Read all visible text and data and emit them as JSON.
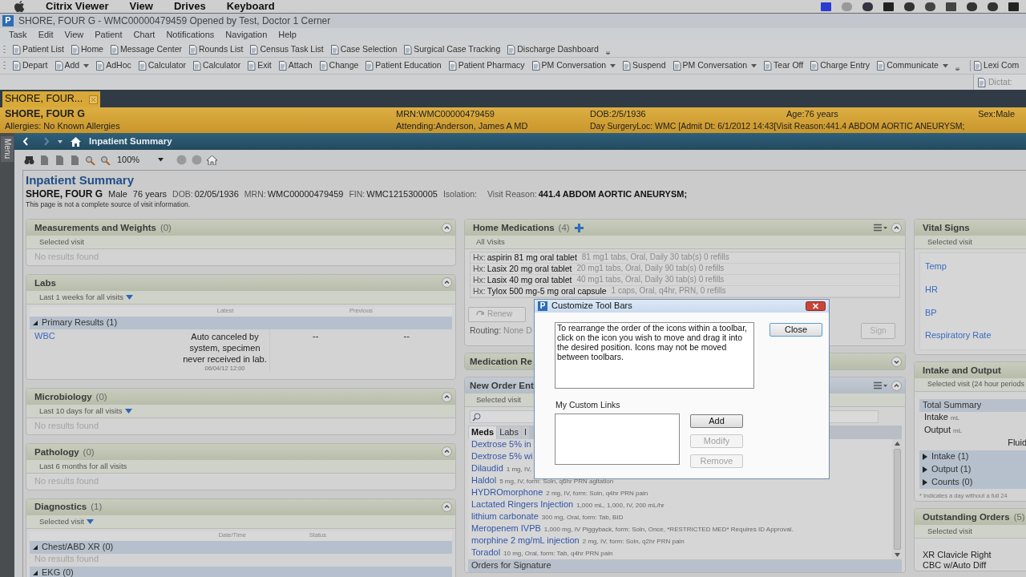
{
  "mac_menu": [
    "Citrix Viewer",
    "View",
    "Drives",
    "Keyboard"
  ],
  "window": {
    "icon_letter": "P",
    "title": "SHORE, FOUR G  - WMC00000479459 Opened by Test, Doctor 1 Cerner"
  },
  "menu": [
    "Task",
    "Edit",
    "View",
    "Patient",
    "Chart",
    "Notifications",
    "Navigation",
    "Help"
  ],
  "toolbar_1": [
    {
      "label": "Patient List",
      "dropdown": false
    },
    {
      "label": "Home",
      "dropdown": false
    },
    {
      "label": "Message Center",
      "dropdown": false
    },
    {
      "label": "Rounds List",
      "dropdown": false
    },
    {
      "label": "Census Task List",
      "dropdown": false
    },
    {
      "label": "Case Selection",
      "dropdown": false
    },
    {
      "label": "Surgical Case Tracking",
      "dropdown": false
    },
    {
      "label": "Discharge Dashboard",
      "dropdown": false
    }
  ],
  "toolbar_2": [
    {
      "label": "Depart",
      "dropdown": false
    },
    {
      "label": "Add",
      "dropdown": true
    },
    {
      "label": "AdHoc",
      "dropdown": false
    },
    {
      "label": "Calculator",
      "dropdown": false
    },
    {
      "label": "Calculator",
      "dropdown": false
    },
    {
      "label": "Exit",
      "dropdown": false
    },
    {
      "label": "Attach",
      "dropdown": false
    },
    {
      "label": "Change",
      "dropdown": false
    },
    {
      "label": "Patient Education",
      "dropdown": false
    },
    {
      "label": "Patient Pharmacy",
      "dropdown": false
    },
    {
      "label": "PM Conversation",
      "dropdown": true
    },
    {
      "label": "Suspend",
      "dropdown": false
    },
    {
      "label": "PM Conversation",
      "dropdown": true
    },
    {
      "label": "Tear Off",
      "dropdown": false
    },
    {
      "label": "Charge Entry",
      "dropdown": false
    },
    {
      "label": "Communicate",
      "dropdown": true
    }
  ],
  "toolbar_2_end": {
    "label": "Lexi Com"
  },
  "toolbar_3": {
    "label": "Dictat:"
  },
  "patient_tab": {
    "label": "SHORE, FOUR..."
  },
  "banner": {
    "name": "SHORE, FOUR G",
    "allergies": "Allergies: No Known Allergies",
    "mrn": "MRN:WMC00000479459",
    "attending": "Attending:Anderson, James A MD",
    "dob": "DOB:2/5/1936",
    "visit": "Day SurgeryLoc: WMC [Admit Dt: 6/1/2012 14:43[Visit Reason:441.4  ABDOM AORTIC ANEURYSM;",
    "age": "Age:76 years",
    "sex": "Sex:Male"
  },
  "side_menu": {
    "label": "Menu"
  },
  "nav": {
    "title": "Inpatient Summary"
  },
  "page_toolbar": {
    "zoom": "100%"
  },
  "page": {
    "title": "Inpatient Summary",
    "patient": "SHORE, FOUR G",
    "demographics": [
      {
        "kind": "plain",
        "value": "Male"
      },
      {
        "kind": "plain",
        "value": "76 years"
      },
      {
        "kind": "field",
        "label": "DOB:",
        "value": "02/05/1936"
      },
      {
        "kind": "field",
        "label": "MRN:",
        "value": "WMC00000479459"
      },
      {
        "kind": "field",
        "label": "FIN:",
        "value": "WMC1215300005"
      },
      {
        "kind": "field",
        "label": "Isolation:"
      },
      {
        "kind": "reason",
        "label": "Visit Reason:",
        "value": "441.4 ABDOM AORTIC ANEURYSM;"
      }
    ],
    "note": "This page is not a complete source of visit information."
  },
  "left_column": [
    {
      "kind": "empty",
      "title": "Measurements and Weights",
      "count": "(0)",
      "collapsed": false,
      "filter": {
        "label": "Selected visit",
        "dropdown": false
      },
      "body": "No results found"
    },
    {
      "kind": "labs",
      "title": "Labs",
      "collapsed": false,
      "filter": {
        "label": "Last 1 weeks for all visits",
        "dropdown": true
      },
      "columns": [
        "Latest",
        "Previous"
      ],
      "groups": [
        {
          "label": "Primary Results (1)",
          "expanded": true,
          "rows": [
            {
              "name": "WBC",
              "latest": "Auto canceled by system, specimen never received in lab.",
              "time": "06/04/12 12:00",
              "previous": [
                "--",
                "--"
              ]
            }
          ]
        }
      ]
    },
    {
      "kind": "empty",
      "title": "Microbiology",
      "count": "(0)",
      "collapsed": false,
      "filter": {
        "label": "Last 10 days for all visits",
        "dropdown": true
      },
      "body": "No results found"
    },
    {
      "kind": "empty",
      "title": "Pathology",
      "count": "(0)",
      "collapsed": false,
      "filter": {
        "label": "Last 6 months for all visits",
        "dropdown": false
      },
      "body": "No results found"
    },
    {
      "kind": "diagnostics",
      "title": "Diagnostics",
      "count": "(1)",
      "collapsed": false,
      "filter": {
        "label": "Selected visit",
        "dropdown": true
      },
      "columns": [
        "Date/Time",
        "Status"
      ],
      "groups": [
        {
          "label": "Chest/ABD XR (0)",
          "expanded": true,
          "body": "No results found"
        },
        {
          "label": "EKG (0)",
          "expanded": true
        }
      ]
    }
  ],
  "home_medications": {
    "title": "Home Medications",
    "count": "(4)",
    "collapsed": false,
    "filter": "All Visits",
    "meds": [
      {
        "prefix": "Hx:",
        "name": "aspirin 81 mg oral tablet",
        "details": "81 mg1 tabs, Oral, Daily  30 tab(s) 0 refills"
      },
      {
        "prefix": "Hx:",
        "name": "Lasix 20 mg oral tablet",
        "details": "20 mg1 tabs, Oral, Daily  90 tab(s) 0 refills"
      },
      {
        "prefix": "Hx:",
        "name": "Lasix 40 mg oral tablet",
        "details": "40 mg1 tabs, Oral, Daily  30 tab(s) 0 refills"
      },
      {
        "prefix": "Hx:",
        "name": "Tylox 500 mg-5 mg oral capsule",
        "details": "1 caps, Oral, q4hr, PRN,  0 refills"
      }
    ],
    "renew_button": "Renew",
    "routing_label": "Routing:",
    "routing_value": "None D",
    "sign_button": "Sign"
  },
  "medication_rec": {
    "title": "Medication Re",
    "collapsed": true
  },
  "new_order_entry": {
    "title": "New Order Ent",
    "collapsed": false,
    "filter": "Selected visit",
    "tabs": [
      {
        "label": "Meds",
        "selected": true
      },
      {
        "label": "Labs",
        "selected": false
      },
      {
        "label": "I",
        "selected": false
      }
    ],
    "orders": [
      {
        "name": "Dextrose 5% in"
      },
      {
        "name": "Dextrose 5% wi"
      },
      {
        "name": "Dilaudid",
        "details": "1 mg, IV,"
      },
      {
        "name": "Haldol",
        "details": "5 mg, IV, form: Soln, q6hr PRN agitation"
      },
      {
        "name": "HYDROmorphone",
        "details": "2 mg, IV, form: Soln, q4hr PRN pain"
      },
      {
        "name": "Lactated Ringers Injection",
        "details": "1,000 mL, 1,000, IV, 200 mL/hr"
      },
      {
        "name": "lithium carbonate",
        "details": "300 mg, Oral, form: Tab, BID"
      },
      {
        "name": "Meropenem IVPB",
        "details": "1,000 mg, IV Piggyback, form: Soln, Once, *RESTRICTED MED* Requires ID Approval."
      },
      {
        "name": "morphine 2 mg/mL injection",
        "details": "2 mg, IV, form: Soln, q2hr PRN pain"
      },
      {
        "name": "Toradol",
        "details": "10 mg, Oral, form: Tab, q4hr PRN pain"
      }
    ],
    "footer": "Orders for Signature"
  },
  "vital_signs": {
    "title": "Vital Signs",
    "filter": "Selected visit",
    "items": [
      "Temp",
      "HR",
      "BP",
      "Respiratory Rate"
    ]
  },
  "intake_output": {
    "title": "Intake and Output",
    "filter": "Selected visit (24 hour periods",
    "summary": "Total Summary",
    "lines": [
      {
        "label": "Intake",
        "unit": "mL"
      },
      {
        "label": "Output",
        "unit": "mL"
      }
    ],
    "fluid": "Fluid",
    "groups": [
      {
        "label": "Intake (1)",
        "expanded": false
      },
      {
        "label": "Output (1)",
        "expanded": false
      },
      {
        "label": "Counts (0)",
        "expanded": false
      }
    ],
    "note": "* Indicates a day without a full 24"
  },
  "outstanding_orders": {
    "title": "Outstanding Orders",
    "count": "(5)",
    "filter": "Selected visit",
    "items": [
      "XR Clavicle Right",
      "CBC w/Auto Diff"
    ]
  },
  "dialog": {
    "icon_letter": "P",
    "title": "Customize Tool Bars",
    "instructions": "To rearrange the order of the icons within a toolbar, click on the icon you wish to move and drag it into the desired position. Icons may not be moved between toolbars.",
    "close_button": "Close",
    "links_label": "My Custom Links",
    "buttons": [
      {
        "label": "Add",
        "disabled": false
      },
      {
        "label": "Modify",
        "disabled": true
      },
      {
        "label": "Remove",
        "disabled": true
      }
    ]
  }
}
